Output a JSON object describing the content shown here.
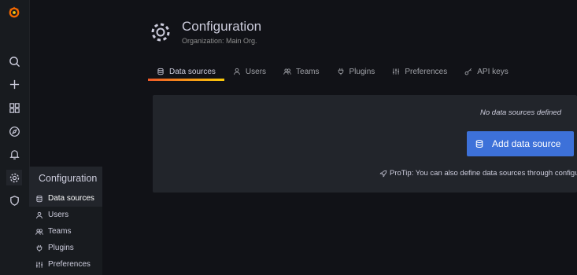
{
  "sidebar": {
    "items": [
      {
        "icon": "search-icon"
      },
      {
        "icon": "plus-icon"
      },
      {
        "icon": "dashboards-icon"
      },
      {
        "icon": "explore-icon"
      },
      {
        "icon": "bell-icon"
      },
      {
        "icon": "gear-icon"
      },
      {
        "icon": "shield-icon"
      }
    ]
  },
  "flyout": {
    "title": "Configuration",
    "items": [
      {
        "label": "Data sources",
        "icon": "database-icon",
        "active": true
      },
      {
        "label": "Users",
        "icon": "user-icon"
      },
      {
        "label": "Teams",
        "icon": "users-icon"
      },
      {
        "label": "Plugins",
        "icon": "plug-icon"
      },
      {
        "label": "Preferences",
        "icon": "sliders-icon"
      }
    ]
  },
  "header": {
    "title": "Configuration",
    "subtitle": "Organization: Main Org."
  },
  "tabs": [
    {
      "label": "Data sources",
      "icon": "database-icon",
      "active": true
    },
    {
      "label": "Users",
      "icon": "user-icon"
    },
    {
      "label": "Teams",
      "icon": "users-icon"
    },
    {
      "label": "Plugins",
      "icon": "plug-icon"
    },
    {
      "label": "Preferences",
      "icon": "sliders-icon"
    },
    {
      "label": "API keys",
      "icon": "key-icon"
    }
  ],
  "empty_state": {
    "message": "No data sources defined",
    "button_label": "Add data source",
    "protip": "ProTip: You can also define data sources through configuration files."
  },
  "colors": {
    "accent": "#3d71d9",
    "tab_underline_start": "#f05a28",
    "tab_underline_end": "#fbca0a",
    "background": "#111217",
    "panel": "#22252b"
  }
}
